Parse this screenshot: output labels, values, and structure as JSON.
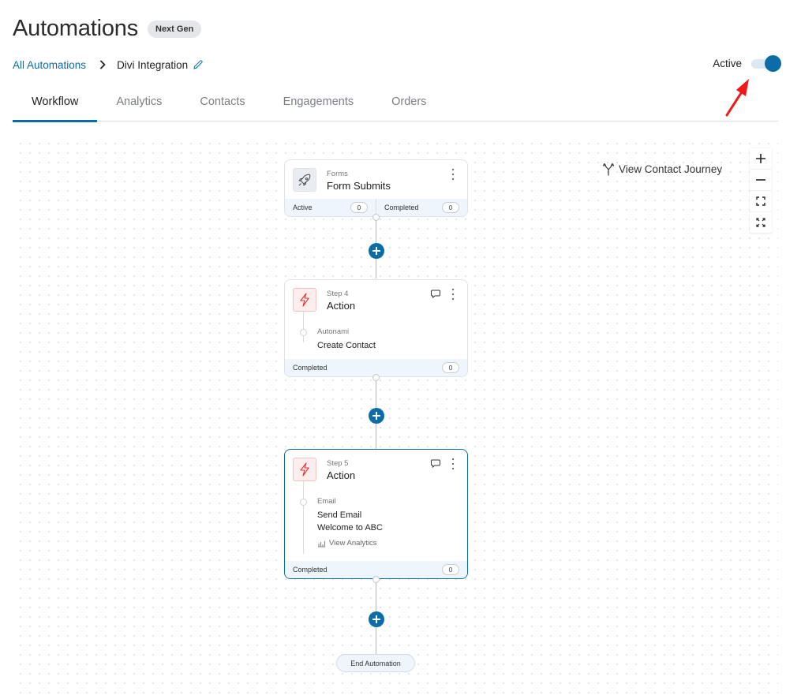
{
  "header": {
    "title": "Automations",
    "badge": "Next Gen"
  },
  "breadcrumb": {
    "parent": "All Automations",
    "current": "Divi Integration",
    "separator_icon": "chevron-right-icon",
    "edit_icon": "pencil-icon"
  },
  "status": {
    "label": "Active",
    "enabled": true,
    "accent": "#0a6da8"
  },
  "tabs": [
    {
      "label": "Workflow",
      "active": true
    },
    {
      "label": "Analytics",
      "active": false
    },
    {
      "label": "Contacts",
      "active": false
    },
    {
      "label": "Engagements",
      "active": false
    },
    {
      "label": "Orders",
      "active": false
    }
  ],
  "canvas": {
    "contact_journey_label": "View Contact Journey",
    "zoom_controls": [
      "zoom-in-icon",
      "zoom-out-icon",
      "fit-screen-icon",
      "fullscreen-icon"
    ]
  },
  "nodes": {
    "trigger": {
      "category": "Forms",
      "title": "Form Submits",
      "icon": "rocket-icon",
      "stats": [
        {
          "label": "Active",
          "value": "0"
        },
        {
          "label": "Completed",
          "value": "0"
        }
      ]
    },
    "step4": {
      "step": "Step 4",
      "title": "Action",
      "icon": "lightning-icon",
      "category": "Autonami",
      "name": "Create Contact",
      "footer_label": "Completed",
      "footer_value": "0"
    },
    "step5": {
      "step": "Step 5",
      "title": "Action",
      "icon": "lightning-icon",
      "category": "Email",
      "name": "Send Email",
      "subject": "Welcome to ABC",
      "analytics_link": "View Analytics",
      "footer_label": "Completed",
      "footer_value": "0"
    },
    "end": {
      "label": "End Automation"
    }
  }
}
